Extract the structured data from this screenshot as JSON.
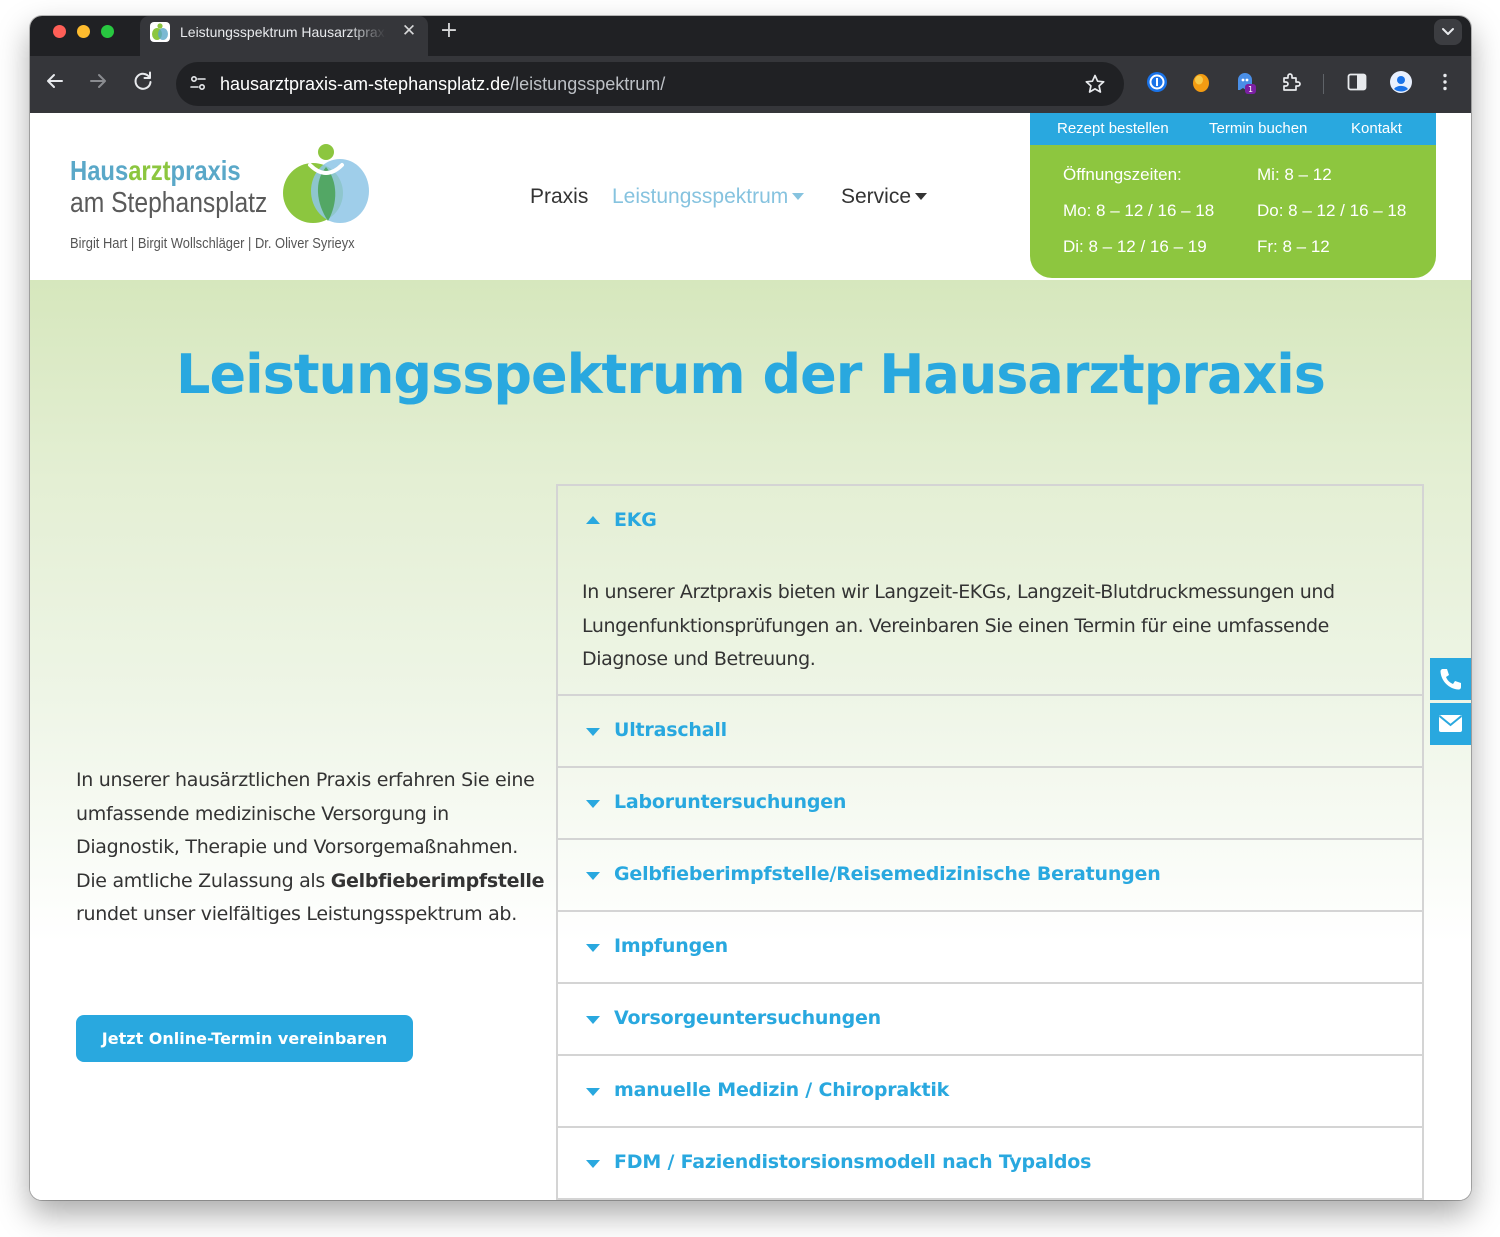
{
  "browser": {
    "tab_title": "Leistungsspektrum Hausarztpraxis am Stephansplatz",
    "new_tab_label": "+",
    "close_tab_label": "✕",
    "url_host": "hausarztpraxis-am-stephansplatz.de",
    "url_path": "/leistungsspektrum/",
    "extension_badge": "1"
  },
  "logo": {
    "part_haus": "Haus",
    "part_arzt": "arzt",
    "part_praxis": "praxis",
    "line2": "am Stephansplatz",
    "doctors": "Birgit Hart | Birgit Wollschläger | Dr. Oliver Syrieyx"
  },
  "nav": {
    "praxis": "Praxis",
    "leistungsspektrum": "Leistungsspektrum",
    "service": "Service"
  },
  "topbar": {
    "rezept": "Rezept bestellen",
    "termin": "Termin buchen",
    "kontakt": "Kontakt"
  },
  "hours": {
    "heading": "Öffnungszeiten:",
    "mo": "Mo: 8 – 12 / 16 – 18",
    "di": "Di: 8 – 12 / 16 – 19",
    "mi": "Mi: 8 – 12",
    "do": "Do: 8 – 12 / 16 – 18",
    "fr": "Fr: 8 – 12"
  },
  "hero": {
    "title": "Leistungsspektrum der Hausarztpraxis"
  },
  "intro": {
    "text1": "In unserer hausärztlichen Praxis erfahren Sie eine umfassende medizinische Versorgung in Diagnostik, Therapie und Vorsorgemaßnahmen.",
    "text2_before": "Die amtliche Zulassung als ",
    "text2_bold": "Gelbfieberimpfstelle",
    "text2_after": " rundet unser vielfältiges Leistungsspektrum ab.",
    "cta": "Jetzt Online-Termin vereinbaren"
  },
  "accordion": {
    "expanded_title": "EKG",
    "expanded_body": "In unserer Arztpraxis bieten wir Langzeit-EKGs, Langzeit-Blutdruckmessungen und Lungenfunktionsprüfungen an. Vereinbaren Sie einen Termin für eine umfassende Diagnose und Betreuung.",
    "items": [
      "Ultraschall",
      "Laboruntersuchungen",
      "Gelbfieberimpfstelle/Reisemedizinische Beratungen",
      "Impfungen",
      "Vorsorgeuntersuchungen",
      "manuelle Medizin / Chiropraktik",
      "FDM / Faziendistorsionsmodell nach Typaldos"
    ]
  },
  "colors": {
    "brand_blue": "#29a8df",
    "brand_green": "#8dc63f",
    "nav_active": "#86c3df"
  },
  "icons": {
    "side_phone": "phone-icon",
    "side_mail": "mail-icon"
  }
}
